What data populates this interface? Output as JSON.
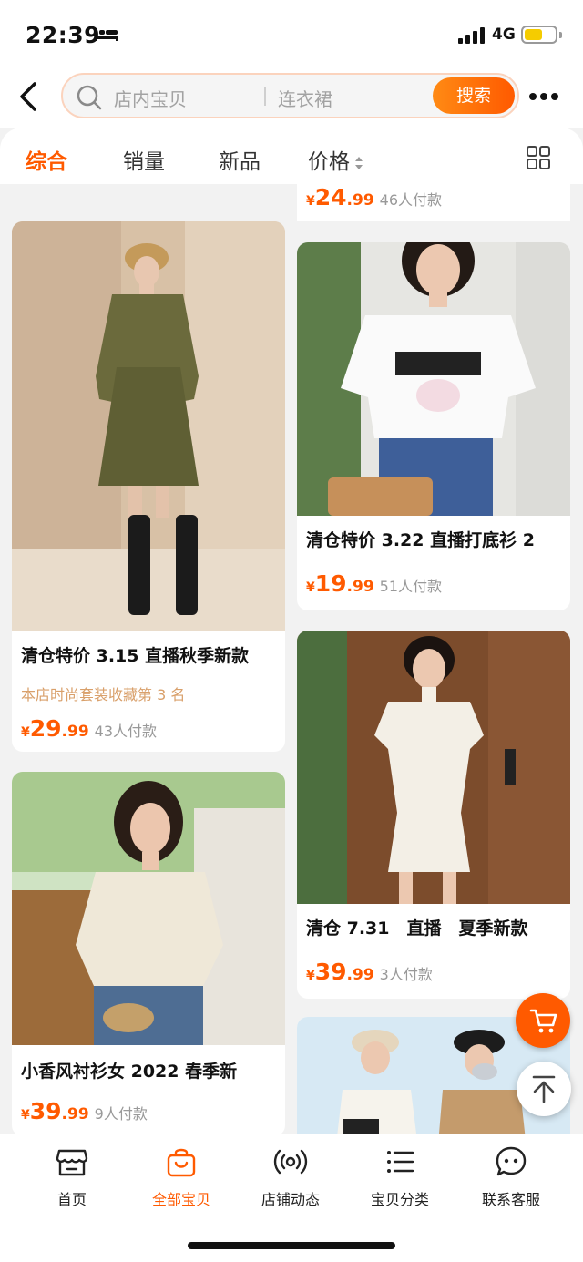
{
  "status_bar": {
    "time": "22:39",
    "network": "4G",
    "battery_level": 0.6
  },
  "header": {
    "back_icon": "chevron-left-icon",
    "search": {
      "scope_text": "店内宝贝",
      "query": "连衣裙",
      "button_label": "搜索"
    },
    "more_icon": "more-dots-icon"
  },
  "tabs": {
    "items": [
      {
        "label": "综合",
        "active": true
      },
      {
        "label": "销量",
        "active": false
      },
      {
        "label": "新品",
        "active": false
      },
      {
        "label": "价格",
        "active": false
      }
    ],
    "layout_toggle_icon": "grid-view-icon"
  },
  "products": {
    "partial_top_right": {
      "price_int": "24",
      "price_dec": ".99",
      "sold": "46人付款"
    },
    "left": [
      {
        "title": "清仓特价 3.15 直播秋季新款",
        "rank": "本店时尚套装收藏第 3 名",
        "price_int": "29",
        "price_dec": ".99",
        "sold": "43人付款"
      },
      {
        "title": "小香风衬衫女 2022 春季新",
        "price_int": "39",
        "price_dec": ".99",
        "sold": "9人付款"
      }
    ],
    "right": [
      {
        "title": "清仓特价 3.22 直播打底衫 2",
        "price_int": "19",
        "price_dec": ".99",
        "sold": "51人付款"
      },
      {
        "title": "清仓 7.31　直播　夏季新款",
        "price_int": "39",
        "price_dec": ".99",
        "sold": "3人付款"
      }
    ],
    "currency_symbol": "¥"
  },
  "floating": {
    "cart_icon": "cart-icon",
    "top_icon": "back-to-top-icon"
  },
  "bottom_nav": {
    "items": [
      {
        "label": "首页",
        "icon": "store-icon",
        "active": false
      },
      {
        "label": "全部宝贝",
        "icon": "shopping-bag-icon",
        "active": true
      },
      {
        "label": "店铺动态",
        "icon": "broadcast-icon",
        "active": false
      },
      {
        "label": "宝贝分类",
        "icon": "list-icon",
        "active": false
      },
      {
        "label": "联系客服",
        "icon": "chat-face-icon",
        "active": false
      }
    ]
  },
  "colors": {
    "accent": "#ff5a00",
    "rank_text": "#d9a06b",
    "muted": "#999999"
  }
}
